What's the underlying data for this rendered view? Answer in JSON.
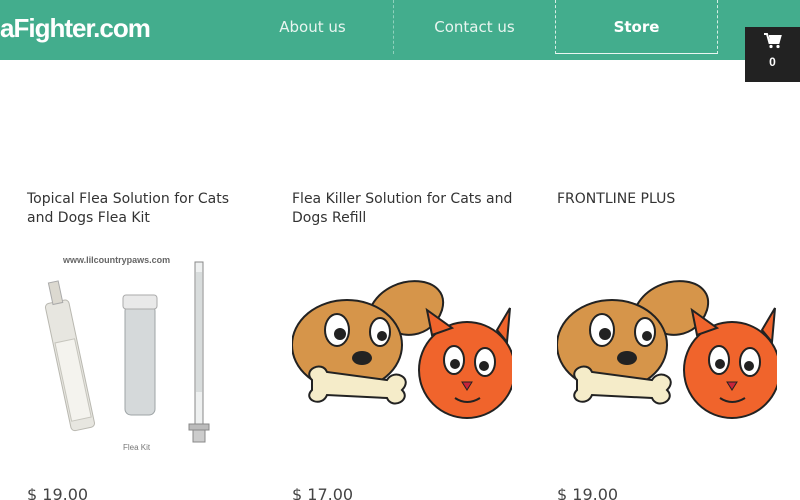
{
  "header": {
    "logo_text": "aFighter.com",
    "nav": [
      {
        "label": "About us"
      },
      {
        "label": "Contact us"
      },
      {
        "label": "Store"
      }
    ],
    "cart": {
      "icon": "cart-icon",
      "count": "0"
    }
  },
  "products": [
    {
      "title": "Topical Flea Solution for Cats and Dogs Flea Kit",
      "price": "$ 19.00",
      "image_text": "www.lilcountrypaws.com",
      "image_caption": "Flea Kit"
    },
    {
      "title": "Flea Killer Solution for Cats and Dogs Refill",
      "price": "$ 17.00"
    },
    {
      "title": "FRONTLINE PLUS",
      "price": "$ 19.00"
    }
  ],
  "colors": {
    "header": "#43ad8d",
    "cart_bg": "#222222"
  }
}
